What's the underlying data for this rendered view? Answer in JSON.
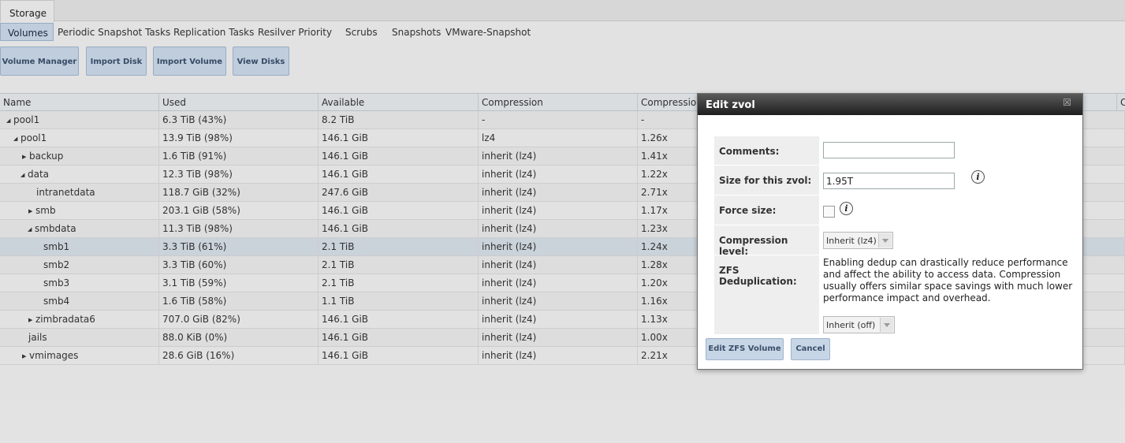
{
  "top_tab": "Storage",
  "subtabs": [
    "Volumes",
    "Periodic Snapshot Tasks",
    "Replication Tasks",
    "Resilver Priority",
    "Scrubs",
    "Snapshots",
    "VMware-Snapshot"
  ],
  "toolbar": {
    "volume_manager": "Volume Manager",
    "import_disk": "Import Disk",
    "import_volume": "Import Volume",
    "view_disks": "View Disks"
  },
  "table": {
    "columns": [
      "Name",
      "Used",
      "Available",
      "Compression",
      "Compression",
      "C"
    ],
    "rows": [
      {
        "name": "pool1",
        "used": "6.3 TiB (43%)",
        "available": "8.2 TiB",
        "compression": "-",
        "ratio": "-"
      },
      {
        "name": "pool1",
        "used": "13.9 TiB (98%)",
        "available": "146.1 GiB",
        "compression": "lz4",
        "ratio": "1.26x"
      },
      {
        "name": "backup",
        "used": "1.6 TiB (91%)",
        "available": "146.1 GiB",
        "compression": "inherit (lz4)",
        "ratio": "1.41x"
      },
      {
        "name": "data",
        "used": "12.3 TiB (98%)",
        "available": "146.1 GiB",
        "compression": "inherit (lz4)",
        "ratio": "1.22x"
      },
      {
        "name": "intranetdata",
        "used": "118.7 GiB (32%)",
        "available": "247.6 GiB",
        "compression": "inherit (lz4)",
        "ratio": "2.71x"
      },
      {
        "name": "smb",
        "used": "203.1 GiB (58%)",
        "available": "146.1 GiB",
        "compression": "inherit (lz4)",
        "ratio": "1.17x"
      },
      {
        "name": "smbdata",
        "used": "11.3 TiB (98%)",
        "available": "146.1 GiB",
        "compression": "inherit (lz4)",
        "ratio": "1.23x"
      },
      {
        "name": "smb1",
        "used": "3.3 TiB (61%)",
        "available": "2.1 TiB",
        "compression": "inherit (lz4)",
        "ratio": "1.24x"
      },
      {
        "name": "smb2",
        "used": "3.3 TiB (60%)",
        "available": "2.1 TiB",
        "compression": "inherit (lz4)",
        "ratio": "1.28x"
      },
      {
        "name": "smb3",
        "used": "3.1 TiB (59%)",
        "available": "2.1 TiB",
        "compression": "inherit (lz4)",
        "ratio": "1.20x"
      },
      {
        "name": "smb4",
        "used": "1.6 TiB (58%)",
        "available": "1.1 TiB",
        "compression": "inherit (lz4)",
        "ratio": "1.16x"
      },
      {
        "name": "zimbradata6",
        "used": "707.0 GiB (82%)",
        "available": "146.1 GiB",
        "compression": "inherit (lz4)",
        "ratio": "1.13x"
      },
      {
        "name": "jails",
        "used": "88.0 KiB (0%)",
        "available": "146.1 GiB",
        "compression": "inherit (lz4)",
        "ratio": "1.00x"
      },
      {
        "name": "vmimages",
        "used": "28.6 GiB (16%)",
        "available": "146.1 GiB",
        "compression": "inherit (lz4)",
        "ratio": "2.21x"
      }
    ]
  },
  "dialog": {
    "title": "Edit zvol",
    "close_glyph": "☒",
    "comments_label": "Comments:",
    "comments_value": "",
    "size_label": "Size for this zvol:",
    "size_value": "1.95T",
    "force_label": "Force size:",
    "compression_label": "Compression level:",
    "compression_value": "Inherit (lz4)",
    "dedup_label": "ZFS Deduplication:",
    "dedup_help": "Enabling dedup can drastically reduce performance and affect the ability to access data. Compression usually offers similar space savings with much lower performance impact and overhead.",
    "dedup_value": "Inherit (off)",
    "info_glyph": "i",
    "submit_label": "Edit ZFS Volume",
    "cancel_label": "Cancel"
  },
  "icons": {
    "expanded": "◢",
    "collapsed": "▶",
    "info": "info-icon",
    "close": "close-icon"
  },
  "colors": {
    "accent_button": "#c7d6e6",
    "dialog_title": "#2a2a2a",
    "selected_row": "#d3dbe3"
  }
}
